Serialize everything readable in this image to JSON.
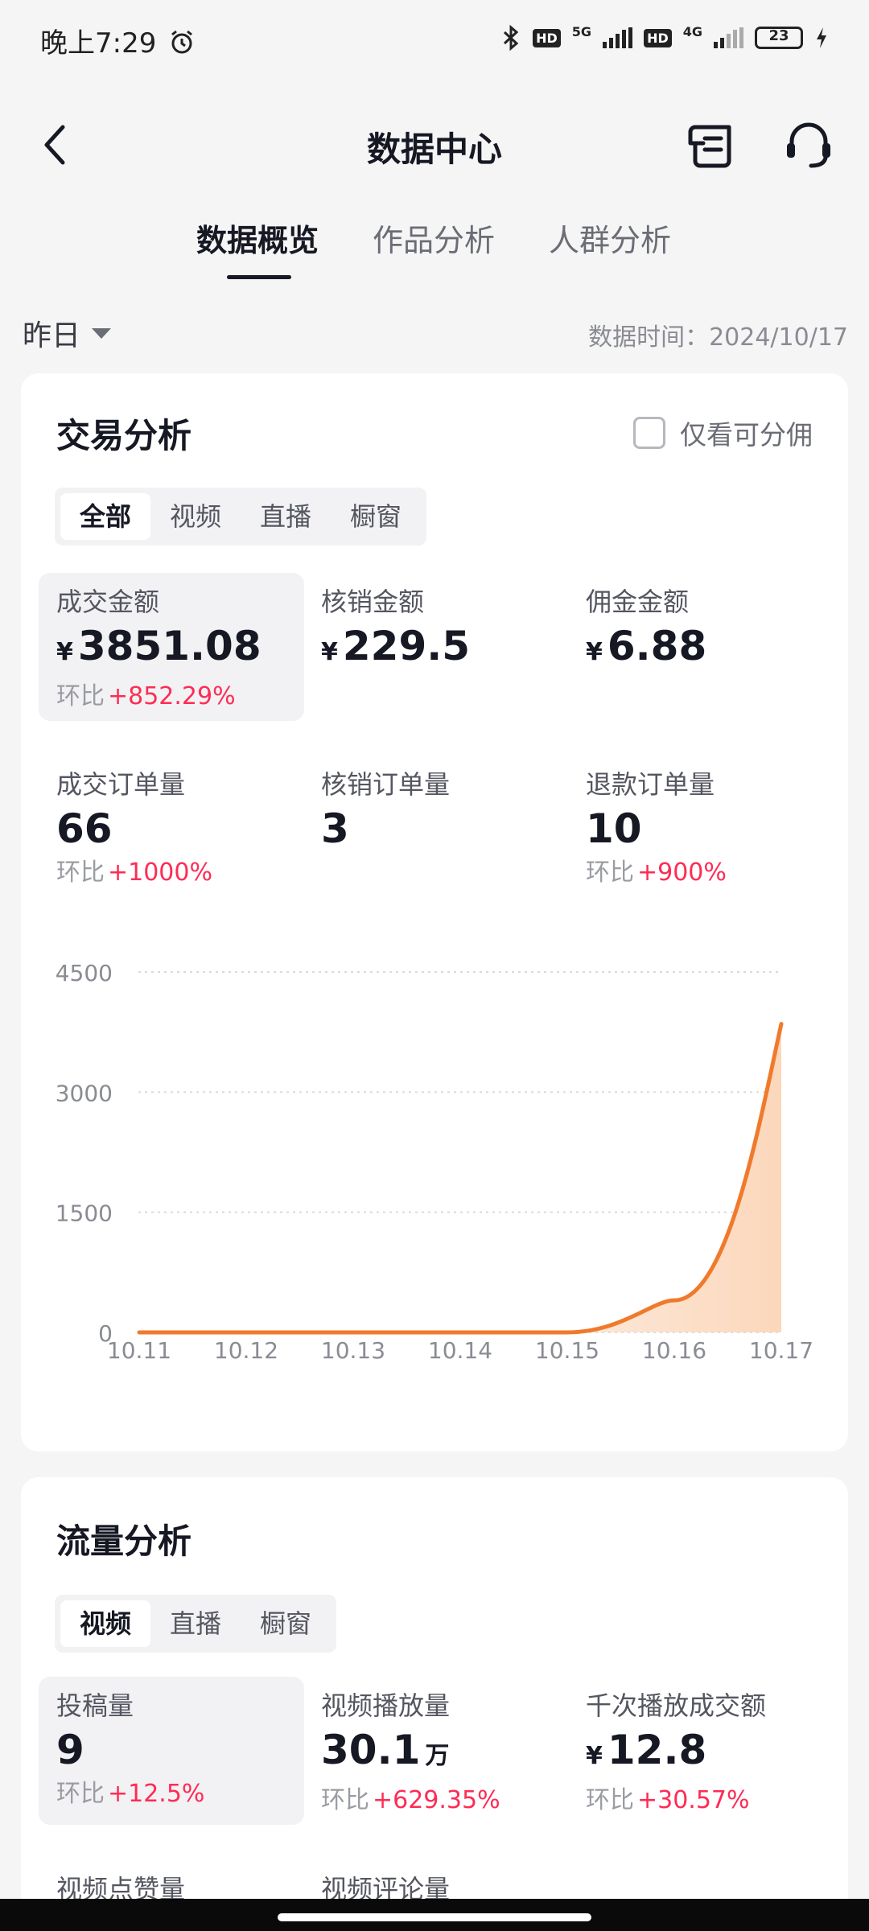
{
  "status": {
    "time": "晚上7:29",
    "network1": "5G",
    "network2": "4G",
    "hd": "HD",
    "battery": "23"
  },
  "nav": {
    "title": "数据中心"
  },
  "tabs": [
    {
      "label": "数据概览",
      "active": true
    },
    {
      "label": "作品分析",
      "active": false
    },
    {
      "label": "人群分析",
      "active": false
    }
  ],
  "filter": {
    "date_label": "昨日",
    "data_time": "数据时间：2024/10/17"
  },
  "trade": {
    "title": "交易分析",
    "checkbox_label": "仅看可分佣",
    "segments": [
      "全部",
      "视频",
      "直播",
      "橱窗"
    ],
    "metrics": [
      {
        "label": "成交金额",
        "currency": "¥",
        "value": "3851.08",
        "change_prefix": "环比",
        "change": "+852.29%"
      },
      {
        "label": "核销金额",
        "currency": "¥",
        "value": "229.5",
        "change_prefix": "",
        "change": ""
      },
      {
        "label": "佣金金额",
        "currency": "¥",
        "value": "6.88",
        "change_prefix": "",
        "change": ""
      },
      {
        "label": "成交订单量",
        "currency": "",
        "value": "66",
        "change_prefix": "环比",
        "change": "+1000%"
      },
      {
        "label": "核销订单量",
        "currency": "",
        "value": "3",
        "change_prefix": "",
        "change": ""
      },
      {
        "label": "退款订单量",
        "currency": "",
        "value": "10",
        "change_prefix": "环比",
        "change": "+900%"
      }
    ]
  },
  "chart_data": {
    "type": "line",
    "categories": [
      "10.11",
      "10.12",
      "10.13",
      "10.14",
      "10.15",
      "10.16",
      "10.17"
    ],
    "series": [
      {
        "values": [
          0,
          0,
          0,
          0,
          0,
          400,
          3851.08
        ]
      }
    ],
    "yticks": [
      "0",
      "1500",
      "3000",
      "4500"
    ],
    "ylim": [
      0,
      4500
    ],
    "grid": true,
    "line_color": "#f07a2c"
  },
  "traffic": {
    "title": "流量分析",
    "segments": [
      "视频",
      "直播",
      "橱窗"
    ],
    "metrics": [
      {
        "label": "投稿量",
        "currency": "",
        "value": "9",
        "unit": "",
        "change_prefix": "环比",
        "change": "+12.5%"
      },
      {
        "label": "视频播放量",
        "currency": "",
        "value": "30.1",
        "unit": "万",
        "change_prefix": "环比",
        "change": "+629.35%"
      },
      {
        "label": "千次播放成交额",
        "currency": "¥",
        "value": "12.8",
        "unit": "",
        "change_prefix": "环比",
        "change": "+30.57%"
      },
      {
        "label": "视频点赞量"
      },
      {
        "label": "视频评论量"
      }
    ]
  }
}
